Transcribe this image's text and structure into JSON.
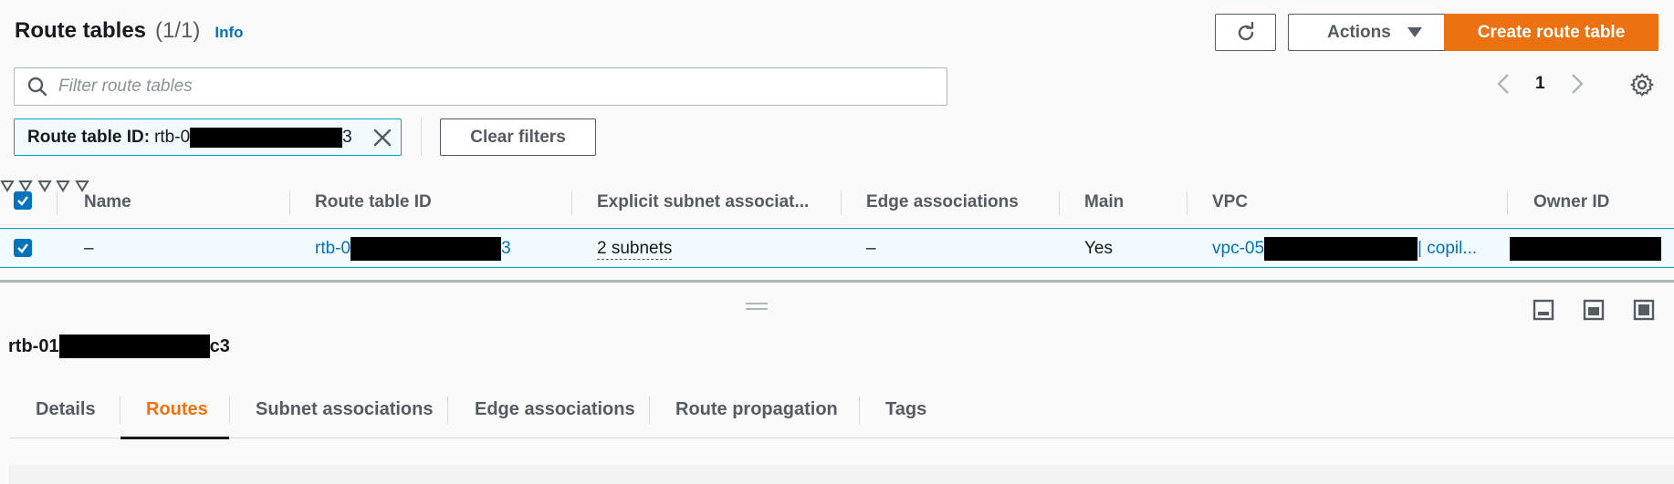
{
  "header": {
    "title": "Route tables",
    "count": "(1/1)",
    "info": "Info"
  },
  "toolbar": {
    "actions_label": "Actions",
    "create_label": "Create route table"
  },
  "search": {
    "placeholder": "Filter route tables"
  },
  "pagination": {
    "page": "1"
  },
  "filter_token": {
    "label": "Route table ID:",
    "prefix": "rtb-0",
    "suffix": "3"
  },
  "clear_filters_label": "Clear filters",
  "table": {
    "columns": [
      "Name",
      "Route table ID",
      "Explicit subnet associat...",
      "Edge associations",
      "Main",
      "VPC",
      "Owner ID"
    ],
    "rows": [
      {
        "name": "–",
        "route_table_id_prefix": "rtb-0",
        "route_table_id_suffix": "3",
        "explicit_subnet": "2 subnets",
        "edge": "–",
        "main": "Yes",
        "vpc_prefix": "vpc-05",
        "vpc_suffix": "| copil..."
      }
    ]
  },
  "detail": {
    "title_prefix": "rtb-01",
    "title_suffix": "c3"
  },
  "tabs": [
    "Details",
    "Routes",
    "Subnet associations",
    "Edge associations",
    "Route propagation",
    "Tags"
  ],
  "active_tab": "Routes",
  "colors": {
    "accent": "#ec7211",
    "link": "#0073bb",
    "selection": "#f1faff"
  }
}
